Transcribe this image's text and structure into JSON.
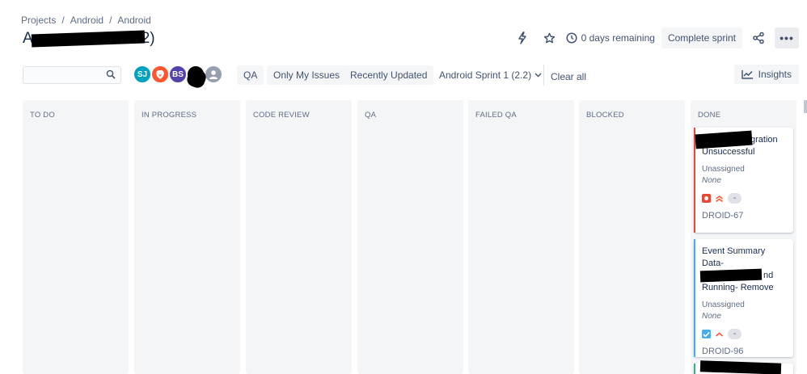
{
  "breadcrumb": [
    "Projects",
    "Android",
    "Android"
  ],
  "page_title": {
    "visible_prefix": "A",
    "visible_suffix": "2)"
  },
  "top_actions": {
    "lightning_icon": "lightning-icon",
    "star_icon": "star-icon",
    "remaining_label": "0 days remaining",
    "complete_sprint_label": "Complete sprint",
    "share_icon": "share-icon",
    "more_label": "•••"
  },
  "toolbar": {
    "search_placeholder": "",
    "avatars": [
      {
        "initials": "SJ",
        "color": "#00a3bf"
      },
      {
        "initials": "",
        "color": "#ff5630"
      },
      {
        "initials": "BS",
        "color": "#5243aa"
      },
      {
        "initials": "",
        "color": "#000000"
      },
      {
        "initials": "",
        "color": "#97a0af"
      }
    ],
    "filters": [
      "QA",
      "Only My Issues",
      "Recently Updated"
    ],
    "sprint_label": "Android Sprint 1 (2.2)",
    "clear_label": "Clear all",
    "insights_label": "Insights"
  },
  "columns": [
    "TO DO",
    "IN PROGRESS",
    "CODE REVIEW",
    "QA",
    "FAILED QA",
    "BLOCKED",
    "DONE"
  ],
  "cards": [
    {
      "title_visible": "gration",
      "title_line2": "Unsuccessful",
      "assignee": "Unassigned",
      "fix": "None",
      "type": "bug",
      "type_color": "#e5493a",
      "priority_color": "#ff5630",
      "pill": "-",
      "key": "DROID-67",
      "bar_color": "#e5493a"
    },
    {
      "title_line1": "Event Summary Data-",
      "title_line2_visible": "nd",
      "title_line3": "Running- Remove",
      "assignee": "Unassigned",
      "fix": "None",
      "type": "task",
      "type_color": "#4bade8",
      "priority_color": "#ff5630",
      "pill": "-",
      "key": "DROID-96",
      "bar_color": "#4bade8"
    }
  ]
}
